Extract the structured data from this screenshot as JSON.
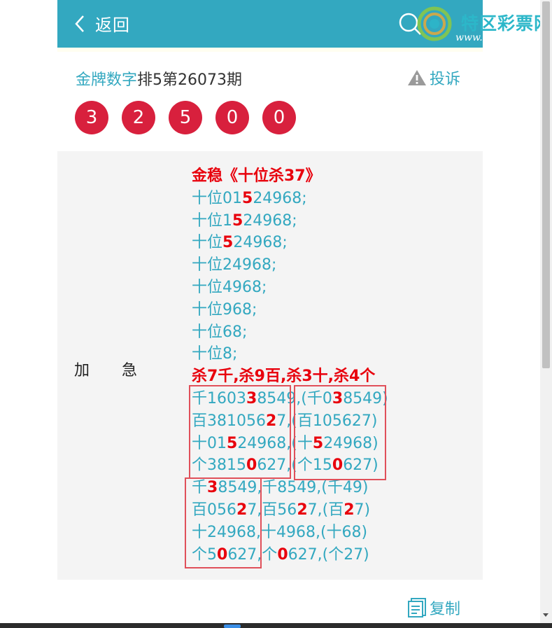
{
  "header": {
    "back_label": "返回",
    "logo_text": "特区彩票网",
    "logo_url": "www.tqcp.net"
  },
  "title": {
    "link_text": "金牌数字",
    "rest_text": "排5第26073期"
  },
  "complain_label": "投诉",
  "balls": [
    "3",
    "2",
    "5",
    "0",
    "0"
  ],
  "side_label": "加急",
  "lines": [
    {
      "parts": [
        {
          "t": "金稳《十位杀37》",
          "red": true
        }
      ],
      "heading": true
    },
    {
      "parts": [
        {
          "t": "十位01"
        },
        {
          "t": "5",
          "red": true
        },
        {
          "t": "24968;"
        }
      ]
    },
    {
      "parts": [
        {
          "t": "十位1"
        },
        {
          "t": "5",
          "red": true
        },
        {
          "t": "24968;"
        }
      ]
    },
    {
      "parts": [
        {
          "t": "十位"
        },
        {
          "t": "5",
          "red": true
        },
        {
          "t": "24968;"
        }
      ]
    },
    {
      "parts": [
        {
          "t": "十位24968;"
        }
      ]
    },
    {
      "parts": [
        {
          "t": "十位4968;"
        }
      ]
    },
    {
      "parts": [
        {
          "t": "十位968;"
        }
      ]
    },
    {
      "parts": [
        {
          "t": "十位68;"
        }
      ]
    },
    {
      "parts": [
        {
          "t": "十位8;"
        }
      ]
    },
    {
      "parts": [
        {
          "t": "杀7千,杀9百,杀3十,杀4个",
          "red": true
        }
      ],
      "heading": true
    },
    {
      "parts": [
        {
          "t": "千1603"
        },
        {
          "t": "3",
          "red": true
        },
        {
          "t": "8549,(千0"
        },
        {
          "t": "3",
          "red": true
        },
        {
          "t": "8549)"
        }
      ]
    },
    {
      "parts": [
        {
          "t": "百381056"
        },
        {
          "t": "2",
          "red": true
        },
        {
          "t": "7,(百10562"
        },
        {
          "t": "",
          "red": true
        },
        {
          "t": "7)"
        }
      ]
    },
    {
      "parts": [
        {
          "t": "十01"
        },
        {
          "t": "5",
          "red": true
        },
        {
          "t": "24968,(十"
        },
        {
          "t": "5",
          "red": true
        },
        {
          "t": "24968)"
        }
      ]
    },
    {
      "parts": [
        {
          "t": "个3815"
        },
        {
          "t": "0",
          "red": true
        },
        {
          "t": "627,(个15"
        },
        {
          "t": "0",
          "red": true
        },
        {
          "t": "627)"
        }
      ]
    },
    {
      "parts": [
        {
          "t": "千"
        },
        {
          "t": "3",
          "red": true
        },
        {
          "t": "8549,千8549,(千49)"
        }
      ]
    },
    {
      "parts": [
        {
          "t": "百056"
        },
        {
          "t": "2",
          "red": true
        },
        {
          "t": "7,百56"
        },
        {
          "t": "2",
          "red": true
        },
        {
          "t": "7,(百"
        },
        {
          "t": "2",
          "red": true
        },
        {
          "t": "7)"
        }
      ]
    },
    {
      "parts": [
        {
          "t": "十24968,十4968,(十68)"
        }
      ]
    },
    {
      "parts": [
        {
          "t": "个5"
        },
        {
          "t": "0",
          "red": true
        },
        {
          "t": "627,个"
        },
        {
          "t": "0",
          "red": true
        },
        {
          "t": "627,(个27)"
        }
      ]
    }
  ],
  "copy_label": "复制",
  "colors": {
    "accent": "#33a8c0",
    "ball": "#d8203d",
    "highlight": "#e8000c"
  }
}
